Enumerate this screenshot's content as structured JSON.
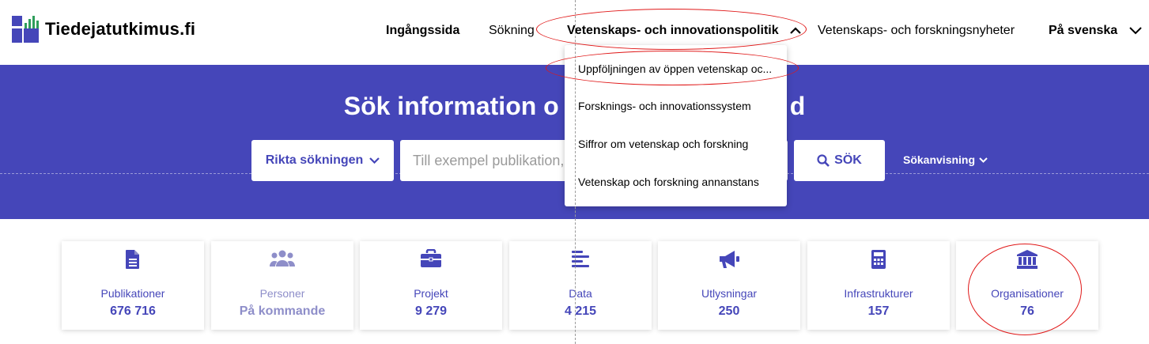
{
  "header": {
    "logo_text": "Tiedejatutkimus.fi",
    "nav": {
      "home": "Ingångssida",
      "search": "Sökning",
      "policy": "Vetenskaps- och innovationspolitik",
      "news": "Vetenskaps- och forskningsnyheter",
      "language": "På svenska"
    }
  },
  "dropdown": {
    "items": [
      "Uppföljningen av öppen vetenskap oc...",
      "Forsknings- och innovationssystem",
      "Siffror om vetenskap och forskning",
      "Vetenskap och forskning annanstans"
    ]
  },
  "hero": {
    "title_left": "Sök information o",
    "title_right": "d",
    "target_label": "Rikta sökningen",
    "search_placeholder": "Till exempel publikation, v",
    "search_button": "SÖK",
    "guide_label": "Sökanvisning"
  },
  "cards": [
    {
      "label": "Publikationer",
      "count": "676 716",
      "icon": "document-icon"
    },
    {
      "label": "Personer",
      "count": "På kommande",
      "icon": "people-icon"
    },
    {
      "label": "Projekt",
      "count": "9 279",
      "icon": "briefcase-icon"
    },
    {
      "label": "Data",
      "count": "4 215",
      "icon": "align-left-icon"
    },
    {
      "label": "Utlysningar",
      "count": "250",
      "icon": "megaphone-icon"
    },
    {
      "label": "Infrastrukturer",
      "count": "157",
      "icon": "calculator-icon"
    },
    {
      "label": "Organisationer",
      "count": "76",
      "icon": "institution-icon"
    }
  ],
  "colors": {
    "brand": "#4546b9",
    "logo_green": "#2f9e5b",
    "annotation_red": "#e01818"
  }
}
